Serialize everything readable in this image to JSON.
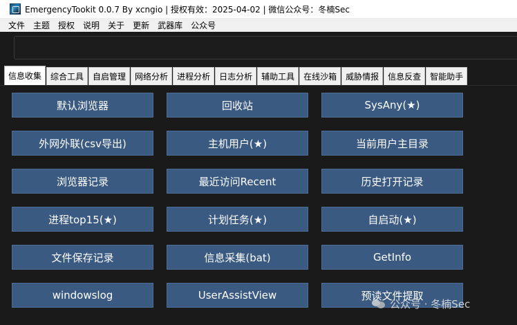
{
  "window": {
    "title": "EmergencyTookit 0.0.7 By xcngio | 授权有效：2025-04-02 | 微信公众号：冬楠Sec",
    "icon": "app-shield-icon"
  },
  "menu": [
    "文件",
    "主题",
    "授权",
    "说明",
    "关于",
    "更新",
    "武器库",
    "公众号"
  ],
  "command_input": {
    "value": "",
    "placeholder": ""
  },
  "tabs": [
    {
      "label": "信息收集",
      "active": true
    },
    {
      "label": "综合工具",
      "active": false
    },
    {
      "label": "自启管理",
      "active": false
    },
    {
      "label": "网络分析",
      "active": false
    },
    {
      "label": "进程分析",
      "active": false
    },
    {
      "label": "日志分析",
      "active": false
    },
    {
      "label": "辅助工具",
      "active": false
    },
    {
      "label": "在线沙箱",
      "active": false
    },
    {
      "label": "威胁情报",
      "active": false
    },
    {
      "label": "信息反查",
      "active": false
    },
    {
      "label": "智能助手",
      "active": false
    }
  ],
  "buttons": [
    [
      "默认浏览器",
      "回收站",
      "SysAny(★)"
    ],
    [
      "外网外联(csv导出)",
      "主机用户(★)",
      "当前用户主目录"
    ],
    [
      "浏览器记录",
      "最近访问Recent",
      "历史打开记录"
    ],
    [
      "进程top15(★)",
      "计划任务(★)",
      "自启动(★)"
    ],
    [
      "文件保存记录",
      "信息采集(bat)",
      "GetInfo"
    ],
    [
      "windowslog",
      "UserAssistView",
      "预读文件提取"
    ]
  ],
  "watermark": {
    "text": "公众号 · 冬楠Sec",
    "icon": "wechat-icon"
  },
  "colors": {
    "background": "#1a1a1a",
    "button": "#3a5a82",
    "button_text": "#ffffff",
    "menubar": "#f0f0f0"
  }
}
